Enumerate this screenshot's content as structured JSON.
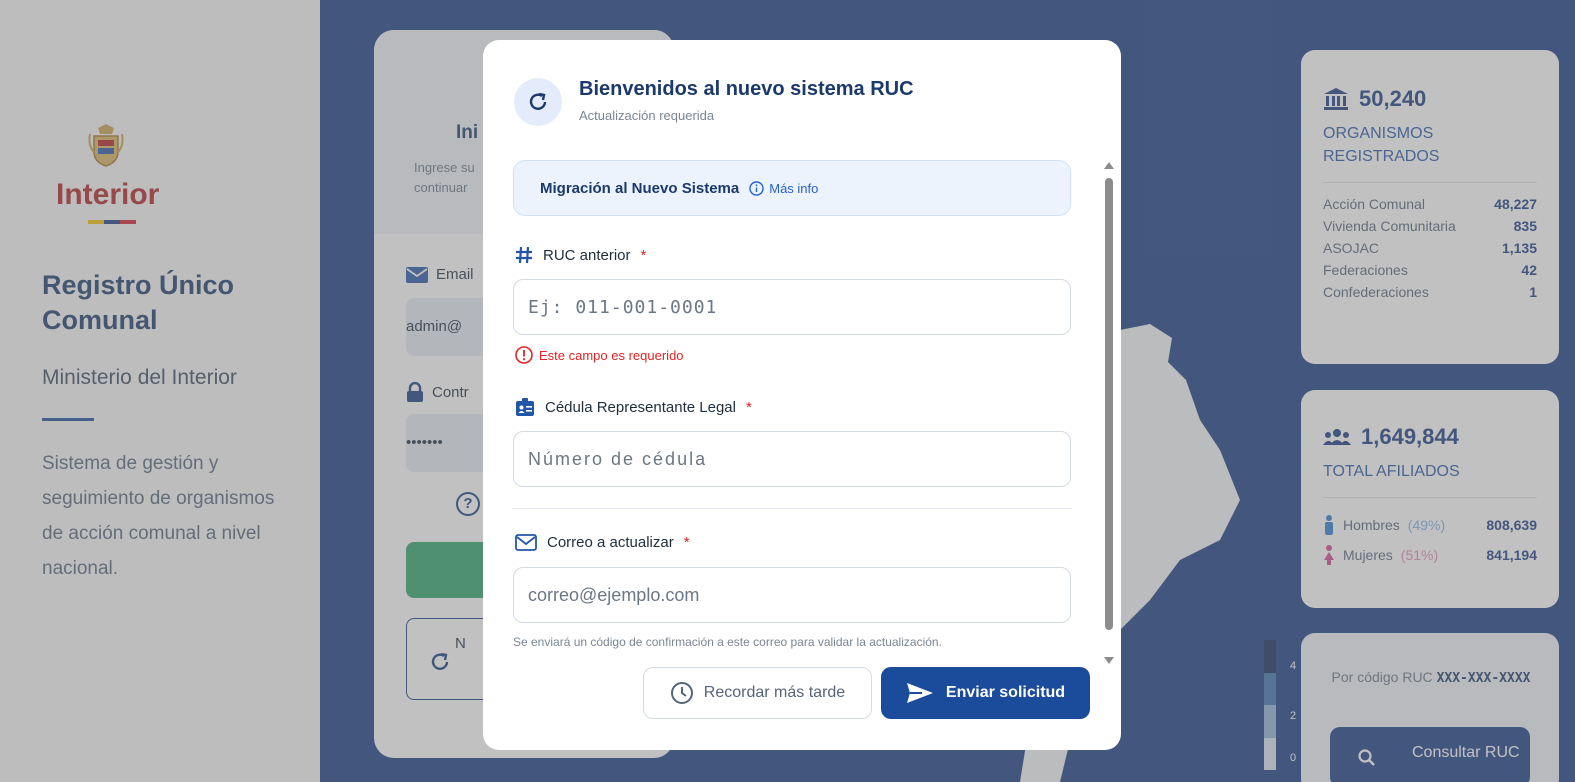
{
  "brand": {
    "logo_text": "Interior",
    "title": "Registro Único Comunal",
    "ministry": "Ministerio del Interior",
    "description": "Sistema de gestión y seguimiento de organismos de acción comunal a nivel nacional."
  },
  "login": {
    "title": "Ini",
    "subtitle": "Ingrese su continuar",
    "email_label": "Email",
    "email_value": "admin@",
    "password_label": "Contr",
    "password_value": "•••••••",
    "alt_button_letter": "N"
  },
  "modal": {
    "title": "Bienvenidos al nuevo sistema RUC",
    "subtitle": "Actualización requerida",
    "banner_title": "Migración al Nuevo Sistema",
    "banner_link": "Más info",
    "fields": {
      "ruc": {
        "label": "RUC anterior",
        "required_mark": "*",
        "placeholder": "Ej: 011-001-0001",
        "error": "Este campo es requerido"
      },
      "cedula": {
        "label": "Cédula Representante Legal",
        "required_mark": "*",
        "placeholder": "Número de cédula"
      },
      "email": {
        "label": "Correo a actualizar",
        "required_mark": "*",
        "placeholder": "correo@ejemplo.com",
        "hint": "Se enviará un código de confirmación a este correo para validar la actualización."
      }
    },
    "buttons": {
      "later": "Recordar más tarde",
      "send": "Enviar solicitud"
    }
  },
  "stats": {
    "organismos": {
      "value": "50,240",
      "caption": "ORGANISMOS REGISTRADOS",
      "rows": [
        {
          "label": "Acción Comunal",
          "value": "48,227"
        },
        {
          "label": "Vivienda Comunitaria",
          "value": "835"
        },
        {
          "label": "ASOJAC",
          "value": "1,135"
        },
        {
          "label": "Federaciones",
          "value": "42"
        },
        {
          "label": "Confederaciones",
          "value": "1"
        }
      ]
    },
    "afiliados": {
      "value": "1,649,844",
      "caption": "TOTAL AFILIADOS",
      "men": {
        "label": "Hombres",
        "pct": "(49%)",
        "value": "808,639"
      },
      "women": {
        "label": "Mujeres",
        "pct": "(51%)",
        "value": "841,194"
      }
    }
  },
  "map_legend": {
    "labels": [
      "4",
      "2",
      "0"
    ]
  },
  "query": {
    "text": "Por código RUC",
    "code": "XXX-XXX-XXXX",
    "button": "Consultar RUC"
  },
  "colors": {
    "primary": "#173c84",
    "accent_red": "#e02424",
    "success": "#2ea46a",
    "women_pink": "#d6458e",
    "men_blue": "#2d7fd1"
  }
}
